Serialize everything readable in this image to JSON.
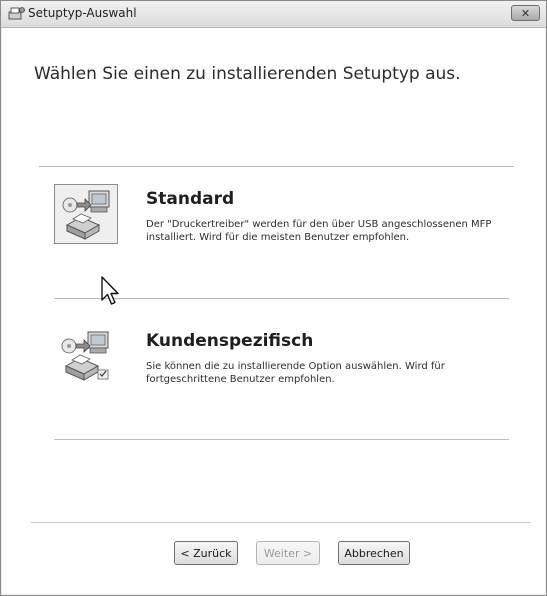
{
  "window": {
    "title": "Setuptyp-Auswahl",
    "close_symbol": "✕"
  },
  "main": {
    "heading": "Wählen Sie einen zu installierenden Setuptyp aus."
  },
  "options": [
    {
      "title": "Standard",
      "description": "Der \"Druckertreiber\" werden für den über USB angeschlossenen MFP installiert.  Wird für die meisten Benutzer empfohlen.",
      "icon": "printer-install-icon"
    },
    {
      "title": "Kundenspezifisch",
      "description": "Sie können die zu installierende Option auswählen. Wird für fortgeschrittene Benutzer empfohlen.",
      "icon": "printer-custom-install-icon"
    }
  ],
  "buttons": {
    "back": "< Zurück",
    "next": "Weiter >",
    "cancel": "Abbrechen"
  }
}
